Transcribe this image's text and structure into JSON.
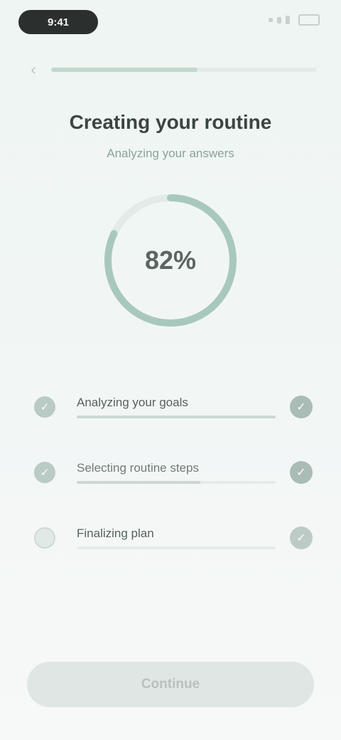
{
  "status_bar": {
    "time": "9:41"
  },
  "header": {
    "back_icon": "chevron-left-icon",
    "progress": 0.55
  },
  "main": {
    "title": "Creating your routine",
    "subtitle": "Analyzing your answers",
    "ring": {
      "progress": 0.82,
      "label": "82%"
    }
  },
  "steps": [
    {
      "label": "Analyzing your goals",
      "state": "done",
      "progress": 1.0,
      "icon": "check-icon"
    },
    {
      "label": "Selecting routine steps",
      "state": "in-progress",
      "progress": 0.62,
      "icon": "check-icon"
    },
    {
      "label": "Finalizing plan",
      "state": "pending",
      "progress": 0.0,
      "icon": "check-icon"
    }
  ],
  "footer": {
    "cta_label": "Continue"
  },
  "colors": {
    "accent": "#a9c8bd",
    "ring_track": "#e2ebe7",
    "cta_disabled": "#e0e6e4"
  }
}
